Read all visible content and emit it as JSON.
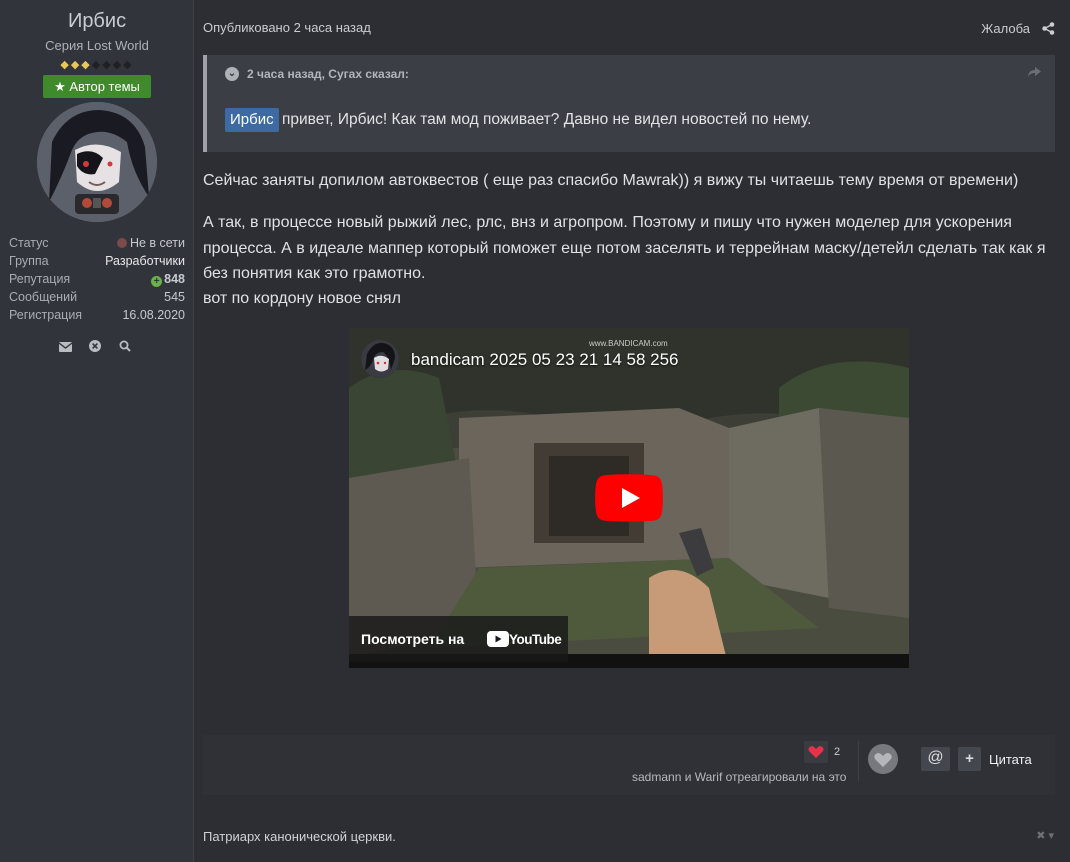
{
  "author": {
    "name": "Ирбис",
    "title": "Серия Lost World",
    "rank_filled": 3,
    "rank_total": 7,
    "badge": "Автор темы",
    "stats": [
      {
        "key": "Статус",
        "value": "Не в сети"
      },
      {
        "key": "Группа",
        "value": "Разработчики"
      },
      {
        "key": "Репутация",
        "value": "848"
      },
      {
        "key": "Сообщений",
        "value": "545"
      },
      {
        "key": "Регистрация",
        "value": "16.08.2020"
      }
    ],
    "actions": [
      "envelope-icon",
      "ignore-icon",
      "search-icon"
    ]
  },
  "post": {
    "date": "Опубликовано 2 часа назад",
    "report": "Жалоба",
    "quote": {
      "cite": "2 часа назад, Сугах сказал:",
      "mention": "Ирбис",
      "text": "привет, Ирбис! Как там мод поживает? Давно не видел новостей по нему."
    },
    "paragraphs": [
      "Сейчас заняты допилом автоквестов ( еще раз спасибо Mawrak)) я вижу ты читаешь тему время от времени)",
      "А так, в процессе новый рыжий лес, рлс, внз и агропром. Поэтому и пишу что нужен моделер для ускорения процесса. А в идеале маппер который поможет еще потом заселять и террейнам маску/детейл сделать так как я без понятия как это грамотно.",
      "вот по кордону новое снял"
    ],
    "video": {
      "title": "bandicam 2025 05 23 21 14 58 256",
      "watch_on": "Посмотреть на",
      "youtube": "YouTube"
    }
  },
  "reactions": {
    "count": "2",
    "who": "sadmann и Warif отреагировали на это",
    "mention_label": "@",
    "plus_label": "+",
    "quote_label": "Цитата"
  },
  "signature": "Патриарх канонической церкви.",
  "colors": {
    "background": "#2c2e33",
    "sidebar": "#31343a",
    "badge_green": "#3f8a2a",
    "mention_blue": "#3e6aa3",
    "reputation_green": "#6ab04c",
    "youtube_red": "#ff0000"
  }
}
